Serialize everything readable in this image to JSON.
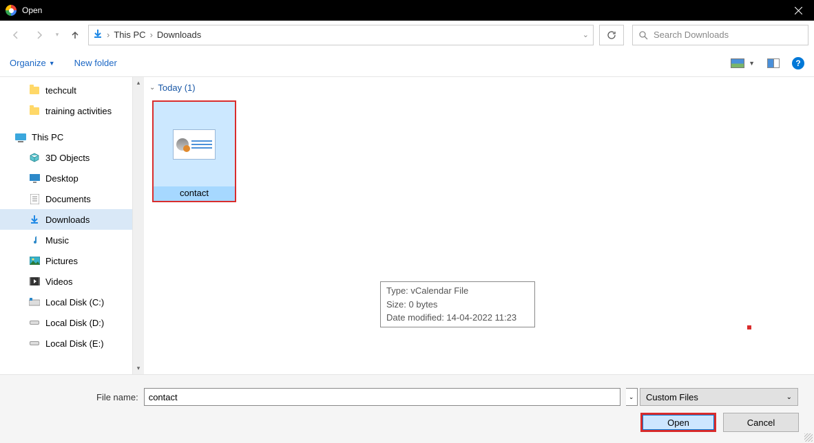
{
  "titlebar": {
    "title": "Open"
  },
  "breadcrumbs": {
    "root": "This PC",
    "current": "Downloads"
  },
  "search": {
    "placeholder": "Search Downloads"
  },
  "toolbar": {
    "organize": "Organize",
    "new_folder": "New folder"
  },
  "sidebar": {
    "folders": [
      {
        "label": "techcult"
      },
      {
        "label": "training activities"
      }
    ],
    "this_pc": "This PC",
    "items": [
      {
        "label": "3D Objects",
        "icon": "cube"
      },
      {
        "label": "Desktop",
        "icon": "desktop"
      },
      {
        "label": "Documents",
        "icon": "doc"
      },
      {
        "label": "Downloads",
        "icon": "download",
        "selected": true
      },
      {
        "label": "Music",
        "icon": "music"
      },
      {
        "label": "Pictures",
        "icon": "picture"
      },
      {
        "label": "Videos",
        "icon": "video"
      },
      {
        "label": "Local Disk (C:)",
        "icon": "disk-c"
      },
      {
        "label": "Local Disk (D:)",
        "icon": "disk"
      },
      {
        "label": "Local Disk (E:)",
        "icon": "disk"
      }
    ]
  },
  "content": {
    "group_label": "Today (1)",
    "file": {
      "name": "contact"
    },
    "tooltip": {
      "line1": "Type: vCalendar File",
      "line2": "Size: 0 bytes",
      "line3": "Date modified: 14-04-2022 11:23"
    }
  },
  "bottom": {
    "filename_label": "File name:",
    "filename_value": "contact",
    "filetype": "Custom Files",
    "open": "Open",
    "cancel": "Cancel"
  }
}
